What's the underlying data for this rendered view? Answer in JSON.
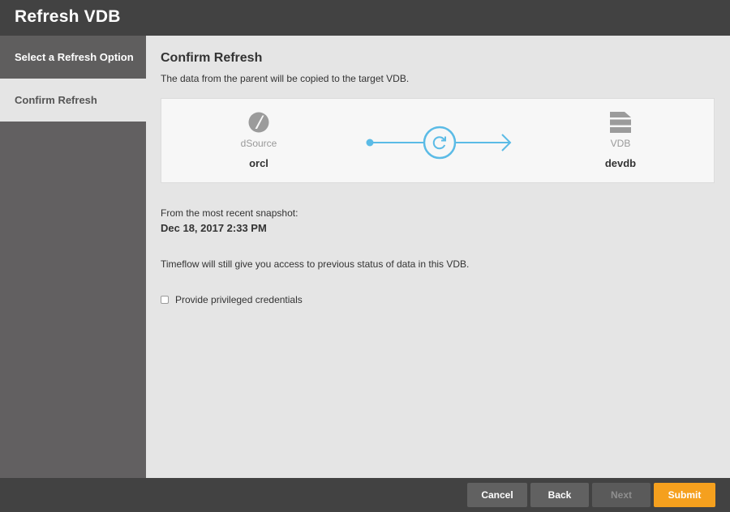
{
  "window": {
    "title": "Refresh VDB"
  },
  "sidebar": {
    "items": [
      {
        "label": "Select a Refresh Option"
      },
      {
        "label": "Confirm Refresh"
      }
    ]
  },
  "main": {
    "heading": "Confirm Refresh",
    "subtitle": "The data from the parent will be copied to the target VDB.",
    "source": {
      "type": "dSource",
      "name": "orcl",
      "icon": "dsource-icon"
    },
    "target": {
      "type": "VDB",
      "name": "devdb",
      "icon": "vdb-stack-icon"
    },
    "flow_icon": "refresh-icon",
    "snapshot_label": "From the most recent snapshot:",
    "snapshot_date": "Dec 18, 2017 2:33 PM",
    "timeflow_note": "Timeflow will still give you access to previous status of data in this VDB.",
    "privileged_checkbox": {
      "label": "Provide privileged credentials",
      "checked": false
    }
  },
  "footer": {
    "cancel_label": "Cancel",
    "back_label": "Back",
    "next_label": "Next",
    "submit_label": "Submit"
  },
  "colors": {
    "titlebar": "#424242",
    "sidebar": "#626061",
    "accent_flow": "#5bbbe6",
    "submit": "#f5a01e"
  }
}
